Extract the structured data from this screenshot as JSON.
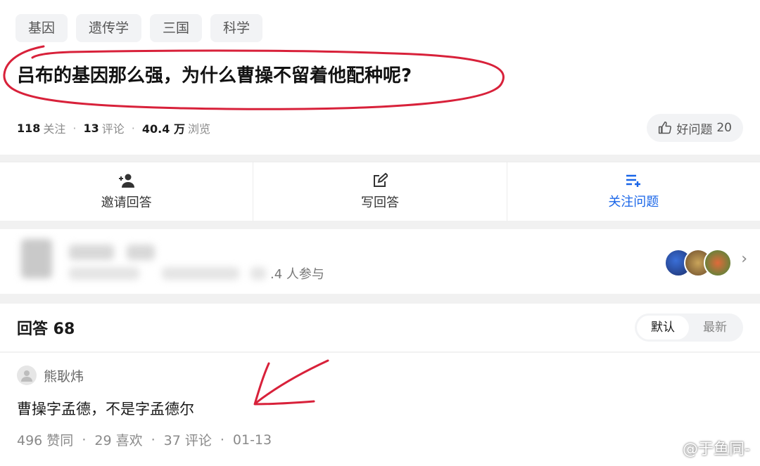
{
  "tags": [
    "基因",
    "遗传学",
    "三国",
    "科学"
  ],
  "question": {
    "title": "吕布的基因那么强，为什么曹操不留着他配种呢?"
  },
  "stats": {
    "followers": "118",
    "followers_label": "关注",
    "comments": "13",
    "comments_label": "评论",
    "views": "40.4 万",
    "views_label": "浏览"
  },
  "good_question": {
    "label": "好问题",
    "count": "20"
  },
  "actions": {
    "invite": "邀请回答",
    "write": "写回答",
    "follow": "关注问题"
  },
  "participation": {
    "text": ".4 人参与"
  },
  "answers": {
    "header": "回答 68",
    "sort_default": "默认",
    "sort_latest": "最新",
    "first": {
      "author": "熊耿炜",
      "content": "曹操字孟德，不是字孟德尔",
      "likes": "496 赞同",
      "favorites": "29 喜欢",
      "comments": "37 评论",
      "date": "01-13"
    }
  },
  "watermark": "@于鱼同-",
  "colors": {
    "accent": "#1a66e8",
    "annotation": "#d8213a"
  }
}
